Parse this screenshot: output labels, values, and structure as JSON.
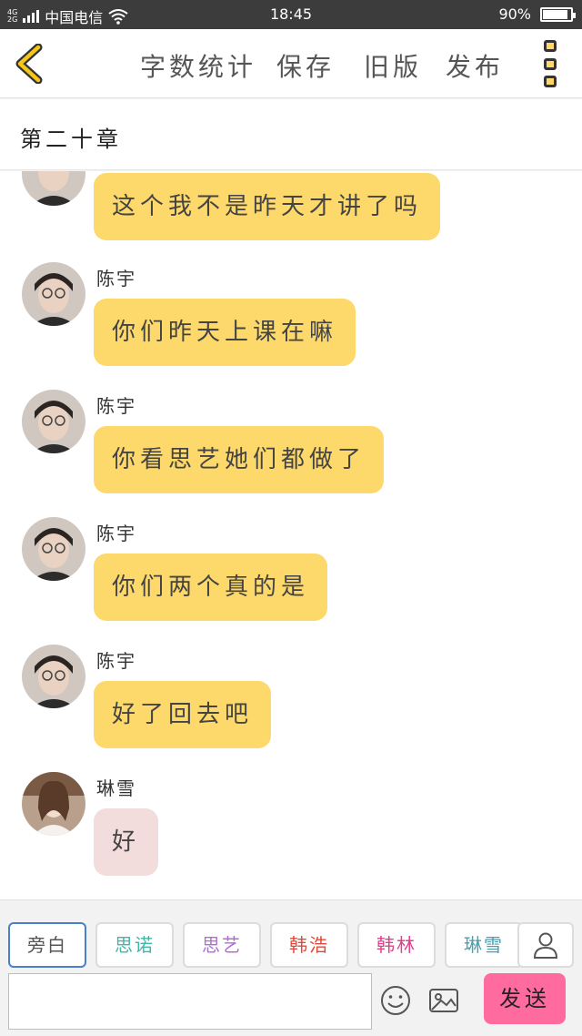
{
  "status_bar": {
    "network_top": "4G",
    "network_bottom": "2G",
    "carrier": "中国电信",
    "time": "18:45",
    "battery_text": "90%",
    "battery_level": 0.9
  },
  "toolbar": {
    "word_count_label": "字数统计",
    "save_label": "保存",
    "old_version_label": "旧版",
    "publish_label": "发布"
  },
  "chapter": {
    "title": "第二十章"
  },
  "messages": [
    {
      "sender": "",
      "text": "这个我不是昨天才讲了吗",
      "style": "yellow"
    },
    {
      "sender": "陈宇",
      "text": "你们昨天上课在嘛",
      "style": "yellow"
    },
    {
      "sender": "陈宇",
      "text": "你看思艺她们都做了",
      "style": "yellow"
    },
    {
      "sender": "陈宇",
      "text": "你们两个真的是",
      "style": "yellow"
    },
    {
      "sender": "陈宇",
      "text": "好了回去吧",
      "style": "yellow"
    },
    {
      "sender": "琳雪",
      "text": "好",
      "style": "pink"
    }
  ],
  "characters": [
    {
      "label": "旁白",
      "color": "#555555",
      "active": true
    },
    {
      "label": "思诺",
      "color": "#3fb8a8",
      "active": false
    },
    {
      "label": "思艺",
      "color": "#b06fd0",
      "active": false
    },
    {
      "label": "韩浩",
      "color": "#e04a3c",
      "active": false
    },
    {
      "label": "韩林",
      "color": "#e0408a",
      "active": false
    },
    {
      "label": "琳雪",
      "color": "#4aa0b0",
      "active": false
    }
  ],
  "composer": {
    "input_value": "",
    "send_label": "发送"
  },
  "icons": {
    "back": "chevron-left-icon",
    "more": "more-vertical-icon",
    "user": "user-icon",
    "emoji": "smiley-icon",
    "image": "image-icon",
    "wifi": "wifi-icon",
    "signal": "signal-icon",
    "battery": "battery-icon"
  },
  "colors": {
    "bubble_yellow": "#fdd86b",
    "bubble_pink": "#f2dcdc",
    "send_button": "#ff6b9e",
    "active_tab_border": "#4a7fc9",
    "back_chevron": "#f5c518"
  }
}
